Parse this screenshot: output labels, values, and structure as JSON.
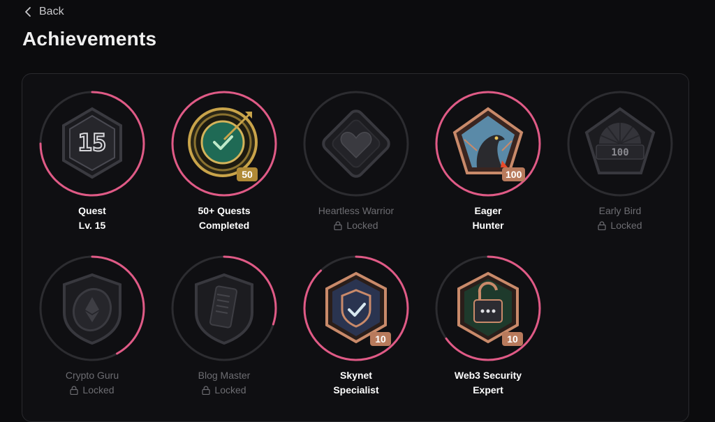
{
  "nav": {
    "back_label": "Back"
  },
  "page": {
    "title": "Achievements"
  },
  "colors": {
    "accent": "#e05a86",
    "track": "#2c2c30",
    "gold": "#c9a44a",
    "bronze": "#c98a6a"
  },
  "achievements": [
    {
      "name": "Quest",
      "sub": "Lv. 15",
      "locked": false,
      "progress": 0.75,
      "icon": "hexagon-15-icon",
      "tag": "",
      "emblem_text": "15"
    },
    {
      "name": "50+ Quests",
      "sub": "Completed",
      "locked": false,
      "progress": 1.0,
      "icon": "target-arrow-icon",
      "tag": "50",
      "emblem_text": ""
    },
    {
      "name": "Heartless Warrior",
      "sub": "Locked",
      "locked": true,
      "progress": 0,
      "icon": "heart-diamond-icon",
      "tag": "",
      "emblem_text": ""
    },
    {
      "name": "Eager",
      "sub": "Hunter",
      "locked": false,
      "progress": 1.0,
      "icon": "falcon-pentagon-icon",
      "tag": "100",
      "emblem_text": ""
    },
    {
      "name": "Early Bird",
      "sub": "Locked",
      "locked": true,
      "progress": 0,
      "icon": "sunrise-pentagon-icon",
      "tag": "",
      "emblem_text": "100"
    },
    {
      "name": "Crypto Guru",
      "sub": "Locked",
      "locked": true,
      "progress": 0.42,
      "icon": "ethereum-shield-icon",
      "tag": "",
      "emblem_text": ""
    },
    {
      "name": "Blog Master",
      "sub": "Locked",
      "locked": true,
      "progress": 0.3,
      "icon": "device-shield-icon",
      "tag": "",
      "emblem_text": ""
    },
    {
      "name": "Skynet",
      "sub": "Specialist",
      "locked": false,
      "progress": 0.88,
      "icon": "shield-check-icon",
      "tag": "10",
      "emblem_text": ""
    },
    {
      "name": "Web3 Security",
      "sub": "Expert",
      "locked": false,
      "progress": 0.65,
      "icon": "unlocked-lock-icon",
      "tag": "10",
      "emblem_text": ""
    }
  ]
}
